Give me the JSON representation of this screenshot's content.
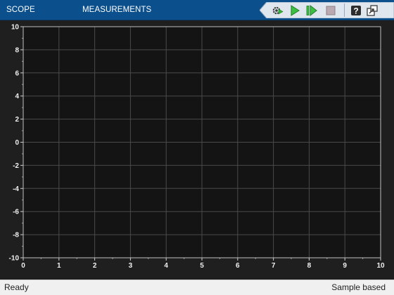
{
  "toolstrip": {
    "tabs": [
      {
        "label": "SCOPE"
      },
      {
        "label": "MEASUREMENTS"
      }
    ],
    "quick_access": [
      {
        "name": "settings-icon"
      },
      {
        "name": "run-icon"
      },
      {
        "name": "step-forward-icon"
      },
      {
        "name": "stop-icon"
      },
      {
        "name": "help-icon"
      },
      {
        "name": "undock-icon"
      }
    ],
    "colors": {
      "bar": "#0b4f8c",
      "run": "#35b23a",
      "stop": "#b9a8b0"
    }
  },
  "chart_data": {
    "type": "line",
    "title": "",
    "xlabel": "",
    "ylabel": "",
    "xlim": [
      0,
      10
    ],
    "ylim": [
      -10,
      10
    ],
    "x_ticks": [
      "0",
      "1",
      "2",
      "3",
      "4",
      "5",
      "6",
      "7",
      "8",
      "9",
      "10"
    ],
    "y_ticks": [
      "10",
      "8",
      "6",
      "4",
      "2",
      "0",
      "-2",
      "-4",
      "-6",
      "-8",
      "-10"
    ],
    "series": [],
    "grid": true,
    "background": "#141414",
    "grid_color": "#4a4a4a"
  },
  "status": {
    "left": "Ready",
    "right": "Sample based"
  }
}
